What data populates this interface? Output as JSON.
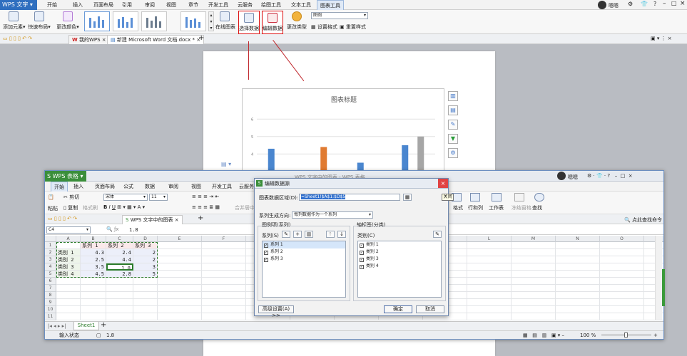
{
  "writer": {
    "app_label": "WPS 文字",
    "menus": [
      "开始",
      "插入",
      "页面布局",
      "引用",
      "审阅",
      "视图",
      "章节",
      "开发工具",
      "云服务",
      "绘图工具",
      "文本工具",
      "图表工具"
    ],
    "active_menu": "图表工具",
    "user": "嗯嗯",
    "ribbon": {
      "add_element": "添加元素",
      "quick_layout": "快速布局",
      "change_color": "更改颜色",
      "online_chart": "在线图表",
      "select_data": "选择数据",
      "edit_data": "编辑数据",
      "change_type": "更改类型",
      "legend_value": "图例",
      "set_format": "设置格式",
      "reset_style": "重置样式"
    },
    "tabs": [
      {
        "label": "我的WPS"
      },
      {
        "label": "新建 Microsoft Word 文档.docx *"
      }
    ],
    "chart": {
      "title": "图表标题",
      "yticks": [
        "6",
        "5",
        "4",
        "3"
      ]
    }
  },
  "chart_data": {
    "type": "bar",
    "title": "图表标题",
    "categories": [
      "类别 1",
      "类别 2",
      "类别 3",
      "类别 4"
    ],
    "series": [
      {
        "name": "系列 1",
        "values": [
          4.3,
          2.5,
          3.5,
          4.5
        ],
        "color": "#4a86cf"
      },
      {
        "name": "系列 2",
        "values": [
          2.4,
          4.4,
          1.8,
          2.8
        ],
        "color": "#e07b32"
      },
      {
        "name": "系列 3",
        "values": [
          2,
          2,
          3,
          5
        ],
        "color": "#a6a6a6"
      }
    ],
    "ylim": [
      2.5,
      6.5
    ]
  },
  "et": {
    "app_label": "WPS 表格",
    "window_title": "WPS 文字中的图表 - WPS 表格",
    "user": "嗯嗯",
    "menus": [
      "开始",
      "插入",
      "页面布局",
      "公式",
      "数据",
      "审阅",
      "视图",
      "开发工具",
      "云服务"
    ],
    "active_menu": "开始",
    "ribbon": {
      "cut": "剪切",
      "paste": "粘贴",
      "copy": "复制",
      "format_painter": "格式刷",
      "font_name": "宋体",
      "font_size": "11",
      "merge_center": "合并居中",
      "format": "格式",
      "row_col": "行和列",
      "worksheet": "工作表",
      "freeze": "冻结窗格",
      "find": "查找"
    },
    "doc_tab": "WPS 文字中的图表",
    "help_search": "点此查找命令",
    "name_box": "C4",
    "formula_value": "1.8",
    "columns": [
      "A",
      "B",
      "C",
      "D",
      "E",
      "F",
      "G",
      "H",
      "I",
      "J",
      "K",
      "L",
      "M",
      "N",
      "O",
      "P",
      "Q",
      "R",
      "S",
      "T",
      "U",
      "V"
    ],
    "rows": [
      [
        "",
        "系列 1",
        "系列 2",
        "系列 3"
      ],
      [
        "类别 1",
        "4.3",
        "2.4",
        "2"
      ],
      [
        "类别 2",
        "2.5",
        "4.4",
        "2"
      ],
      [
        "类别 3",
        "3.5",
        "1.8",
        "3"
      ],
      [
        "类别 4",
        "4.5",
        "2.8",
        "5"
      ]
    ],
    "sheet_tab": "Sheet1",
    "status": "输入状态",
    "status_value": "1.8",
    "zoom": "100 %"
  },
  "dialog": {
    "title": "编辑数据源",
    "range_label": "图表数据区域(D):",
    "range_value": "=Sheet1!$A$1:$D$5",
    "series_dir_label": "系列生成方向:",
    "series_dir_value": "每列数据作为一个系列",
    "legend_group": "图例项(系列)",
    "series_label": "系列(S)",
    "axis_group": "轴标签(分类)",
    "category_label": "类别(C)",
    "series_items": [
      "系列 1",
      "系列 2",
      "系列 3"
    ],
    "category_items": [
      "类别 1",
      "类别 2",
      "类别 3",
      "类别 4"
    ],
    "advanced": "高级设置(A) >>",
    "ok": "确定",
    "cancel": "取消",
    "close_tooltip": "关闭"
  }
}
